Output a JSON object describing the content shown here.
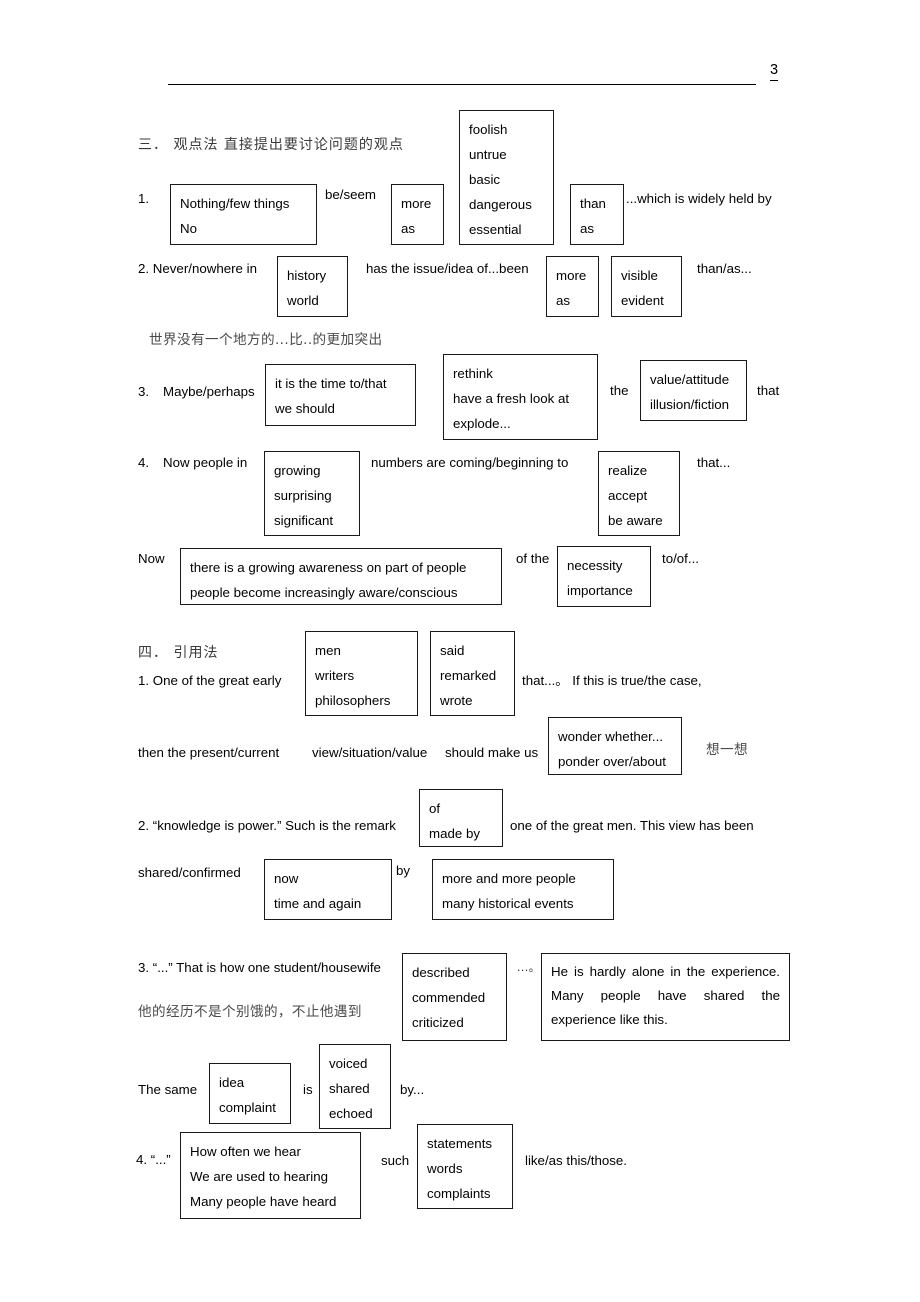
{
  "header": {
    "page_number": "3"
  },
  "section3": {
    "heading": "三．  观点法   直接提出要讨论问题的观点",
    "item1": {
      "number": "1.",
      "subject_box": [
        "Nothing/few things",
        "No"
      ],
      "verb": "be/seem",
      "degree_box": [
        "more",
        "as"
      ],
      "adj_box": [
        "foolish",
        "untrue",
        "basic",
        "dangerous",
        "essential"
      ],
      "conj_box": [
        "than",
        "as"
      ],
      "tail": "...which is widely held by"
    },
    "item2": {
      "lead": "2. Never/nowhere in",
      "place_box": [
        "history",
        "world"
      ],
      "middle": "has the issue/idea of...been",
      "degree_box": [
        "more",
        "as"
      ],
      "adj_box": [
        "visible",
        "evident"
      ],
      "tail": "than/as...",
      "note_cn": "世界没有一个地方的...比..的更加突出"
    },
    "item3": {
      "number": "3.",
      "lead": "Maybe/perhaps",
      "time_box": [
        "it is the time to/that",
        "we should"
      ],
      "verb_box": [
        "rethink",
        "have a fresh look at",
        "explode..."
      ],
      "the": "the",
      "noun_box": [
        "value/attitude",
        "illusion/fiction"
      ],
      "tail": "that"
    },
    "item4": {
      "number": "4.",
      "lead": "Now people in",
      "adj_box": [
        "growing",
        "surprising",
        "significant"
      ],
      "middle": "numbers are coming/beginning to",
      "verb_box": [
        "realize",
        "accept",
        "be aware"
      ],
      "tail": "that...",
      "now": "Now",
      "clause_box": [
        "there is a growing awareness on part of people",
        "people become increasingly aware/conscious"
      ],
      "of_the": "of the",
      "noun_box": [
        "necessity",
        "importance"
      ],
      "tail2": "to/of..."
    }
  },
  "section4": {
    "heading": "四．   引用法",
    "item1": {
      "lead": "1. One of the great early",
      "person_box": [
        "men",
        "writers",
        "philosophers"
      ],
      "verb_box": [
        "said",
        "remarked",
        "wrote"
      ],
      "mid": "that...。 If this is true/the case,",
      "line2a": "then the present/current",
      "line2b": "view/situation/value",
      "line2c": "should make us",
      "think_box": [
        "wonder whether...",
        "ponder over/about"
      ],
      "note_cn": "想一想"
    },
    "item2": {
      "lead": "2. “knowledge is power.” Such is the remark",
      "prep_box": [
        "of",
        "made by"
      ],
      "mid": "one of the great men. This view has been",
      "line2": "shared/confirmed",
      "time_box": [
        "now",
        "time and again"
      ],
      "by": "by",
      "agent_box": [
        "more and more people",
        "many historical events"
      ]
    },
    "item3": {
      "lead": "3. “...” That is how one student/housewife",
      "verb_box": [
        "described",
        "commended",
        "criticized"
      ],
      "ellipsis": "...。",
      "quote_box": [
        "He is hardly alone in the experience.",
        "Many people have shared the",
        "experience like this."
      ],
      "note_cn": "他的经历不是个别饿的，不止他遇到",
      "line2a": "The same",
      "noun_box": [
        "idea",
        "complaint"
      ],
      "is": "is",
      "verb_box2": [
        "voiced",
        "shared",
        "echoed"
      ],
      "by": "by..."
    },
    "item4": {
      "lead": "4. “...”",
      "clause_box": [
        "How often we hear",
        "We are used to hearing",
        "Many people have heard"
      ],
      "such": "such",
      "noun_box": [
        "statements",
        "words",
        "complaints"
      ],
      "tail": "like/as this/those."
    }
  }
}
